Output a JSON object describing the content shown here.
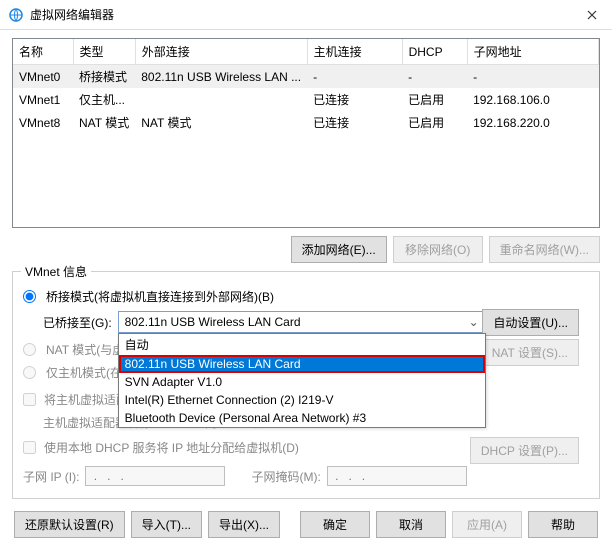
{
  "window": {
    "title": "虚拟网络编辑器"
  },
  "table": {
    "headers": [
      "名称",
      "类型",
      "外部连接",
      "主机连接",
      "DHCP",
      "子网地址"
    ],
    "rows": [
      {
        "c": [
          "VMnet0",
          "桥接模式",
          "802.11n USB Wireless LAN ...",
          "-",
          "-",
          "-"
        ],
        "sel": true
      },
      {
        "c": [
          "VMnet1",
          "仅主机...",
          "",
          "已连接",
          "已启用",
          "192.168.106.0"
        ],
        "sel": false
      },
      {
        "c": [
          "VMnet8",
          "NAT 模式",
          "NAT 模式",
          "已连接",
          "已启用",
          "192.168.220.0"
        ],
        "sel": false
      }
    ]
  },
  "buttons": {
    "add_net": "添加网络(E)...",
    "remove_net": "移除网络(O)",
    "rename_net": "重命名网络(W)...",
    "auto_set": "自动设置(U)...",
    "nat_set": "NAT 设置(S)...",
    "dhcp_set": "DHCP 设置(P)...",
    "restore": "还原默认设置(R)",
    "import": "导入(T)...",
    "export": "导出(X)...",
    "ok": "确定",
    "cancel": "取消",
    "apply": "应用(A)",
    "help": "帮助"
  },
  "info": {
    "legend": "VMnet 信息",
    "bridge_label": "桥接模式(将虚拟机直接连接到外部网络)(B)",
    "bridge_to": "已桥接至(G):",
    "bridge_selected": "802.11n USB Wireless LAN Card",
    "bridge_options": [
      "自动",
      "802.11n USB Wireless LAN Card",
      "SVN Adapter V1.0",
      "Intel(R) Ethernet Connection (2) I219-V",
      "Bluetooth Device (Personal Area Network) #3"
    ],
    "nat_label_a": "NAT 模式(与虚",
    "host_label_a": "仅主机模式(在",
    "host_connect": "将主机虚拟适配器连接到此网络(V)",
    "host_adapter": "主机虚拟适配器名称: VMware 网络适配器 VMnet0",
    "dhcp_label": "使用本地 DHCP 服务将 IP 地址分配给虚拟机(D)",
    "subnet_ip": "子网 IP (I):",
    "subnet_mask": "子网掩码(M):",
    "ip_placeholder": " .   .   ."
  }
}
